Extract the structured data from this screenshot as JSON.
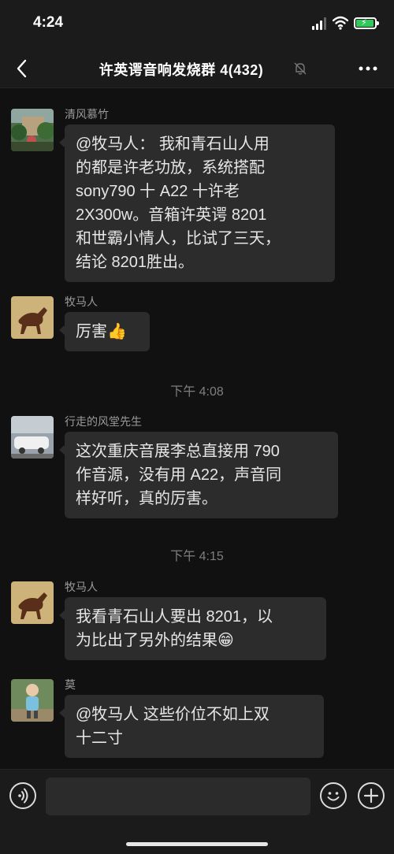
{
  "status_bar": {
    "time": "4:24"
  },
  "header": {
    "title": "许英谔音响发烧群 4(432)"
  },
  "messages": [
    {
      "sender": "清风慕竹",
      "lines": [
        "@牧马人： 我和青石山人用",
        "的都是许老功放，系统搭配",
        "sony790 十 A22 十许老",
        "2X300w。音箱许英谔 8201",
        "和世霸小情人，比试了三天，",
        "结论 8201胜出。"
      ]
    },
    {
      "sender": "牧马人",
      "text": "厉害",
      "emoji": "👍"
    },
    {
      "sender": "行走的风堂先生",
      "lines": [
        "这次重庆音展李总直接用 790",
        "作音源，没有用 A22，声音同",
        "样好听，真的厉害。"
      ]
    },
    {
      "sender": "牧马人",
      "lines": [
        "我看青石山人要出 8201，以",
        "为比出了另外的结果"
      ],
      "emoji": "😁"
    },
    {
      "sender": "莫",
      "lines": [
        "@牧马人 这些价位不如上双",
        "十二寸"
      ]
    }
  ],
  "timestamps": [
    "下午 4:08",
    "下午 4:15"
  ],
  "colors": {
    "bubble": "#2c2c2c",
    "background": "#111111",
    "bar": "#1b1b1b",
    "battery": "#34c759"
  }
}
